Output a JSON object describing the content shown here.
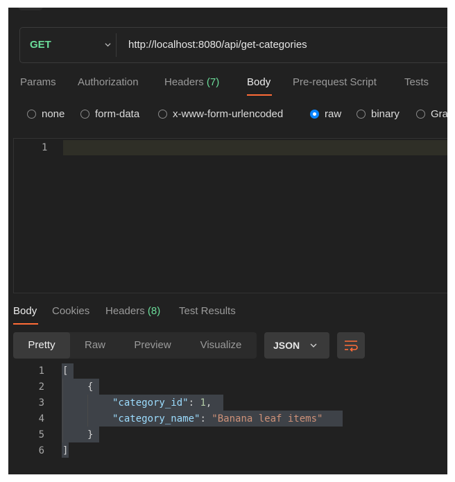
{
  "request": {
    "method": "GET",
    "url": "http://localhost:8080/api/get-categories"
  },
  "request_tabs": [
    {
      "label": "Params"
    },
    {
      "label": "Authorization"
    },
    {
      "label": "Headers",
      "count": "(7)"
    },
    {
      "label": "Body"
    },
    {
      "label": "Pre-request Script"
    },
    {
      "label": "Tests"
    }
  ],
  "active_request_tab": "Body",
  "body_types": [
    "none",
    "form-data",
    "x-www-form-urlencoded",
    "raw",
    "binary",
    "Gra"
  ],
  "selected_body_type": "raw",
  "request_editor": {
    "line_numbers": [
      "1"
    ]
  },
  "response_tabs": [
    {
      "label": "Body"
    },
    {
      "label": "Cookies"
    },
    {
      "label": "Headers",
      "count": "(8)"
    },
    {
      "label": "Test Results"
    }
  ],
  "view_modes": [
    "Pretty",
    "Raw",
    "Preview",
    "Visualize"
  ],
  "active_view_mode": "Pretty",
  "format": "JSON",
  "response_code": {
    "line_numbers": [
      "1",
      "2",
      "3",
      "4",
      "5",
      "6"
    ],
    "lines": {
      "l1": "[",
      "l2": "{",
      "l3_key": "\"category_id\"",
      "l3_sep": ": ",
      "l3_val": "1",
      "l3_end": ",",
      "l4_key": "\"category_name\"",
      "l4_sep": ": ",
      "l4_val": "\"Banana leaf items\"",
      "l5": "}",
      "l6": "]"
    }
  },
  "colors": {
    "accent": "#ff6c37",
    "method": "#6bdd9a",
    "radio_selected": "#0a84ff",
    "json_key": "#9cdcfe",
    "json_number": "#b5cea8",
    "json_string": "#ce9178"
  },
  "icons": [
    "chevron-down-icon",
    "wrap-lines-icon"
  ]
}
